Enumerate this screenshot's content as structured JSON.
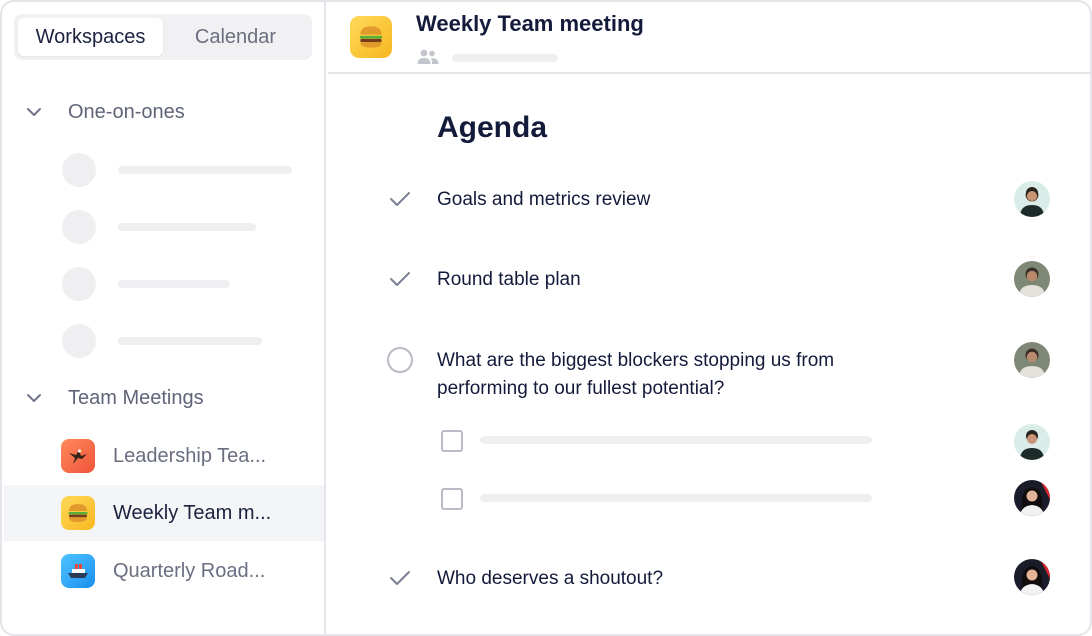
{
  "sidebar": {
    "tabs": [
      {
        "label": "Workspaces",
        "active": true
      },
      {
        "label": "Calendar",
        "active": false
      }
    ],
    "groups": {
      "one_on_ones": {
        "label": "One-on-ones"
      },
      "team_meetings": {
        "label": "Team Meetings",
        "items": [
          {
            "label": "Leadership Tea...",
            "icon": "eagle-emoji-icon",
            "active": false
          },
          {
            "label": "Weekly Team m...",
            "icon": "hamburger-emoji-icon",
            "active": true
          },
          {
            "label": "Quarterly Road...",
            "icon": "ship-emoji-icon",
            "active": false
          }
        ]
      }
    }
  },
  "main": {
    "title": "Weekly Team meeting",
    "header_icon": "hamburger-emoji-icon",
    "agenda_heading": "Agenda",
    "items": [
      {
        "text": "Goals and metrics review",
        "status": "done"
      },
      {
        "text": "Round table plan",
        "status": "done"
      },
      {
        "text": "What are the biggest blockers stopping us from performing to our fullest potential?",
        "status": "open"
      },
      {
        "text": "Who deserves a shoutout?",
        "status": "done"
      }
    ]
  },
  "colors": {
    "text_primary": "#141a3a",
    "text_muted": "#6a6e80",
    "border": "#e3e5ea",
    "placeholder": "#efeff1",
    "active_row": "#f4f5f7"
  }
}
